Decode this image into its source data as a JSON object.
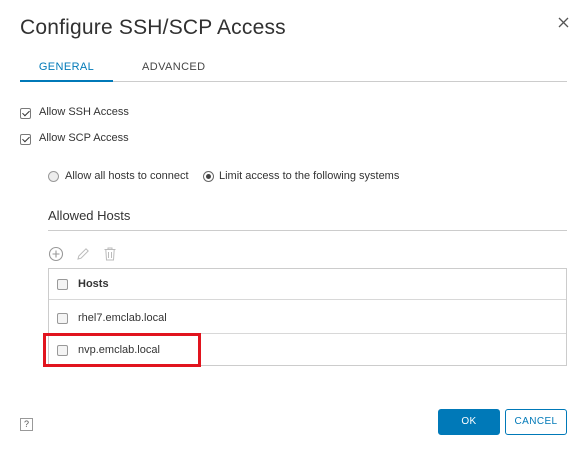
{
  "dialog": {
    "title": "Configure SSH/SCP Access"
  },
  "tabs": [
    {
      "label": "GENERAL",
      "active": true
    },
    {
      "label": "ADVANCED",
      "active": false
    }
  ],
  "options": {
    "ssh_label": "Allow SSH Access",
    "ssh_checked": true,
    "scp_label": "Allow SCP Access",
    "scp_checked": true
  },
  "access": {
    "all_hosts_label": "Allow all hosts to connect",
    "limit_label": "Limit access to the following systems",
    "selected": "limit"
  },
  "allowed_hosts": {
    "section_title": "Allowed Hosts",
    "toolbar_icons": [
      "add-icon",
      "edit-icon",
      "delete-icon"
    ],
    "column_header": "Hosts",
    "rows": [
      "rhel7.emclab.local",
      "nvp.emclab.local"
    ]
  },
  "footer": {
    "help_label": "?",
    "ok_label": "OK",
    "cancel_label": "CANCEL"
  },
  "colors": {
    "accent": "#0079b8",
    "highlight": "#e1141e"
  }
}
